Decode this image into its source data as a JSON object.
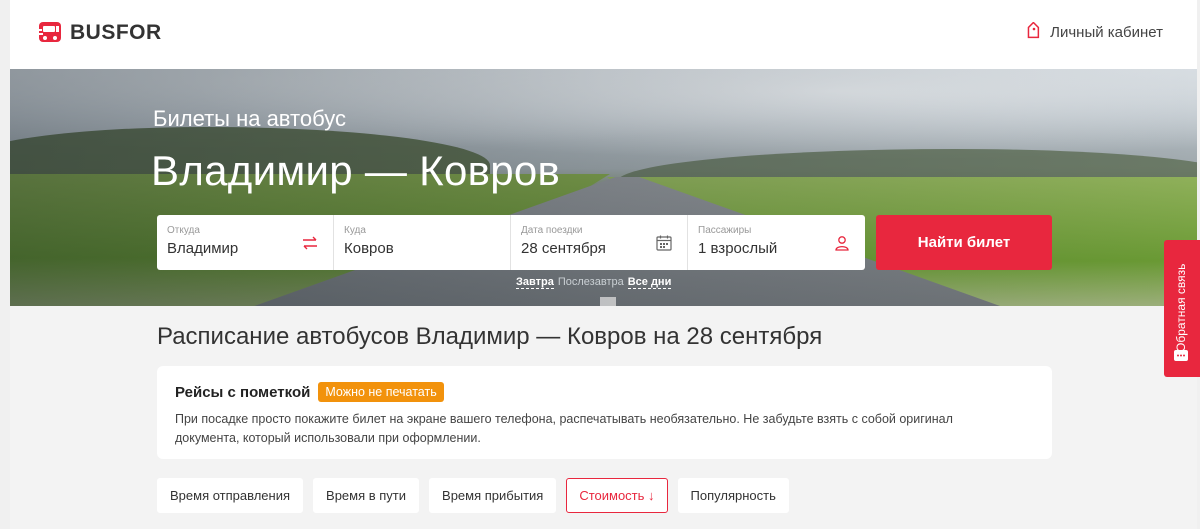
{
  "header": {
    "logo_text": "BUSFOR",
    "account_label": "Личный кабинет"
  },
  "hero": {
    "subtitle": "Билеты на автобус",
    "title": "Владимир — Ковров"
  },
  "search": {
    "from": {
      "label": "Откуда",
      "value": "Владимир"
    },
    "to": {
      "label": "Куда",
      "value": "Ковров"
    },
    "date": {
      "label": "Дата поездки",
      "value": "28 сентября"
    },
    "passengers": {
      "label": "Пассажиры",
      "value": "1 взрослый"
    },
    "submit_label": "Найти билет",
    "quick_dates": [
      "Завтра",
      "Послезавтра",
      "Все дни"
    ]
  },
  "feedback": {
    "label": "Обратная связь"
  },
  "schedule": {
    "title": "Расписание автобусов Владимир — Ковров на 28 сентября"
  },
  "notice": {
    "title": "Рейсы с пометкой",
    "badge": "Можно не печатать",
    "text": "При посадке просто покажите билет на экране вашего телефона, распечатывать необязательно. Не забудьте взять с собой оригинал документа, который использовали при оформлении."
  },
  "sort": {
    "options": [
      "Время отправления",
      "Время в пути",
      "Время прибытия",
      "Стоимость ↓",
      "Популярность"
    ],
    "active": "Стоимость ↓"
  },
  "colors": {
    "accent": "#e8273e",
    "badge": "#f2920c"
  },
  "icons": {
    "swap": "swap-icon",
    "calendar": "calendar-icon",
    "passenger": "user-icon",
    "account": "tag-icon",
    "feedback": "chat-icon"
  }
}
